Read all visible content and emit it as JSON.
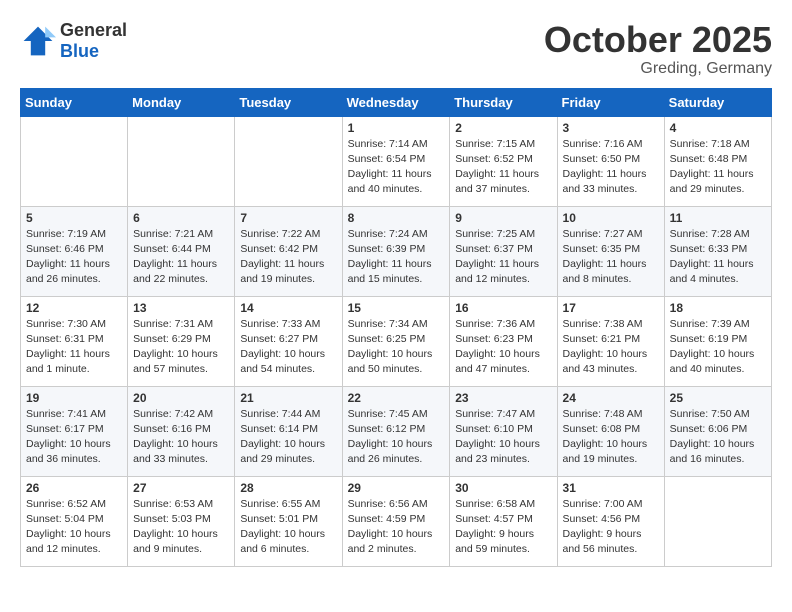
{
  "header": {
    "logo": {
      "general": "General",
      "blue": "Blue"
    },
    "month": "October 2025",
    "location": "Greding, Germany"
  },
  "weekdays": [
    "Sunday",
    "Monday",
    "Tuesday",
    "Wednesday",
    "Thursday",
    "Friday",
    "Saturday"
  ],
  "weeks": [
    [
      {
        "day": "",
        "info": ""
      },
      {
        "day": "",
        "info": ""
      },
      {
        "day": "",
        "info": ""
      },
      {
        "day": "1",
        "info": "Sunrise: 7:14 AM\nSunset: 6:54 PM\nDaylight: 11 hours\nand 40 minutes."
      },
      {
        "day": "2",
        "info": "Sunrise: 7:15 AM\nSunset: 6:52 PM\nDaylight: 11 hours\nand 37 minutes."
      },
      {
        "day": "3",
        "info": "Sunrise: 7:16 AM\nSunset: 6:50 PM\nDaylight: 11 hours\nand 33 minutes."
      },
      {
        "day": "4",
        "info": "Sunrise: 7:18 AM\nSunset: 6:48 PM\nDaylight: 11 hours\nand 29 minutes."
      }
    ],
    [
      {
        "day": "5",
        "info": "Sunrise: 7:19 AM\nSunset: 6:46 PM\nDaylight: 11 hours\nand 26 minutes."
      },
      {
        "day": "6",
        "info": "Sunrise: 7:21 AM\nSunset: 6:44 PM\nDaylight: 11 hours\nand 22 minutes."
      },
      {
        "day": "7",
        "info": "Sunrise: 7:22 AM\nSunset: 6:42 PM\nDaylight: 11 hours\nand 19 minutes."
      },
      {
        "day": "8",
        "info": "Sunrise: 7:24 AM\nSunset: 6:39 PM\nDaylight: 11 hours\nand 15 minutes."
      },
      {
        "day": "9",
        "info": "Sunrise: 7:25 AM\nSunset: 6:37 PM\nDaylight: 11 hours\nand 12 minutes."
      },
      {
        "day": "10",
        "info": "Sunrise: 7:27 AM\nSunset: 6:35 PM\nDaylight: 11 hours\nand 8 minutes."
      },
      {
        "day": "11",
        "info": "Sunrise: 7:28 AM\nSunset: 6:33 PM\nDaylight: 11 hours\nand 4 minutes."
      }
    ],
    [
      {
        "day": "12",
        "info": "Sunrise: 7:30 AM\nSunset: 6:31 PM\nDaylight: 11 hours\nand 1 minute."
      },
      {
        "day": "13",
        "info": "Sunrise: 7:31 AM\nSunset: 6:29 PM\nDaylight: 10 hours\nand 57 minutes."
      },
      {
        "day": "14",
        "info": "Sunrise: 7:33 AM\nSunset: 6:27 PM\nDaylight: 10 hours\nand 54 minutes."
      },
      {
        "day": "15",
        "info": "Sunrise: 7:34 AM\nSunset: 6:25 PM\nDaylight: 10 hours\nand 50 minutes."
      },
      {
        "day": "16",
        "info": "Sunrise: 7:36 AM\nSunset: 6:23 PM\nDaylight: 10 hours\nand 47 minutes."
      },
      {
        "day": "17",
        "info": "Sunrise: 7:38 AM\nSunset: 6:21 PM\nDaylight: 10 hours\nand 43 minutes."
      },
      {
        "day": "18",
        "info": "Sunrise: 7:39 AM\nSunset: 6:19 PM\nDaylight: 10 hours\nand 40 minutes."
      }
    ],
    [
      {
        "day": "19",
        "info": "Sunrise: 7:41 AM\nSunset: 6:17 PM\nDaylight: 10 hours\nand 36 minutes."
      },
      {
        "day": "20",
        "info": "Sunrise: 7:42 AM\nSunset: 6:16 PM\nDaylight: 10 hours\nand 33 minutes."
      },
      {
        "day": "21",
        "info": "Sunrise: 7:44 AM\nSunset: 6:14 PM\nDaylight: 10 hours\nand 29 minutes."
      },
      {
        "day": "22",
        "info": "Sunrise: 7:45 AM\nSunset: 6:12 PM\nDaylight: 10 hours\nand 26 minutes."
      },
      {
        "day": "23",
        "info": "Sunrise: 7:47 AM\nSunset: 6:10 PM\nDaylight: 10 hours\nand 23 minutes."
      },
      {
        "day": "24",
        "info": "Sunrise: 7:48 AM\nSunset: 6:08 PM\nDaylight: 10 hours\nand 19 minutes."
      },
      {
        "day": "25",
        "info": "Sunrise: 7:50 AM\nSunset: 6:06 PM\nDaylight: 10 hours\nand 16 minutes."
      }
    ],
    [
      {
        "day": "26",
        "info": "Sunrise: 6:52 AM\nSunset: 5:04 PM\nDaylight: 10 hours\nand 12 minutes."
      },
      {
        "day": "27",
        "info": "Sunrise: 6:53 AM\nSunset: 5:03 PM\nDaylight: 10 hours\nand 9 minutes."
      },
      {
        "day": "28",
        "info": "Sunrise: 6:55 AM\nSunset: 5:01 PM\nDaylight: 10 hours\nand 6 minutes."
      },
      {
        "day": "29",
        "info": "Sunrise: 6:56 AM\nSunset: 4:59 PM\nDaylight: 10 hours\nand 2 minutes."
      },
      {
        "day": "30",
        "info": "Sunrise: 6:58 AM\nSunset: 4:57 PM\nDaylight: 9 hours\nand 59 minutes."
      },
      {
        "day": "31",
        "info": "Sunrise: 7:00 AM\nSunset: 4:56 PM\nDaylight: 9 hours\nand 56 minutes."
      },
      {
        "day": "",
        "info": ""
      }
    ]
  ]
}
